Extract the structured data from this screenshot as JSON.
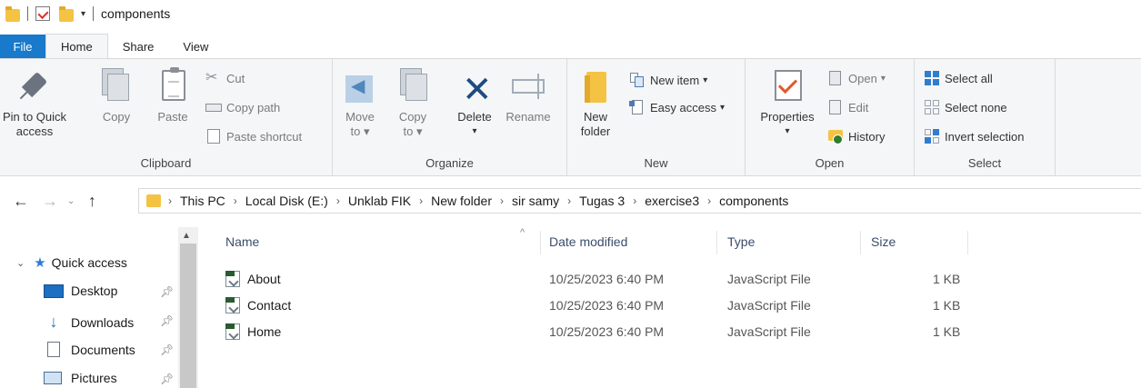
{
  "window": {
    "title": "components"
  },
  "tabs": [
    {
      "label": "File"
    },
    {
      "label": "Home"
    },
    {
      "label": "Share"
    },
    {
      "label": "View"
    }
  ],
  "ribbon": {
    "clipboard": {
      "group_label": "Clipboard",
      "pin_label_1": "Pin to Quick",
      "pin_label_2": "access",
      "copy_label": "Copy",
      "paste_label": "Paste",
      "cut_label": "Cut",
      "copy_path_label": "Copy path",
      "paste_shortcut_label": "Paste shortcut"
    },
    "organize": {
      "group_label": "Organize",
      "move_label_1": "Move",
      "move_label_2": "to",
      "copy_label_1": "Copy",
      "copy_label_2": "to",
      "delete_label": "Delete",
      "rename_label": "Rename"
    },
    "new": {
      "group_label": "New",
      "new_folder_1": "New",
      "new_folder_2": "folder",
      "new_item_label": "New item",
      "easy_access_label": "Easy access"
    },
    "open": {
      "group_label": "Open",
      "properties_label": "Properties",
      "open_label": "Open",
      "edit_label": "Edit",
      "history_label": "History"
    },
    "select": {
      "group_label": "Select",
      "select_all_label": "Select all",
      "select_none_label": "Select none",
      "invert_label": "Invert selection"
    }
  },
  "breadcrumb": [
    "This PC",
    "Local Disk (E:)",
    "Unklab FIK",
    "New folder",
    "sir samy",
    "Tugas 3",
    "exercise3",
    "components"
  ],
  "nav_pane": {
    "quick_access": "Quick access",
    "items": [
      {
        "label": "Desktop"
      },
      {
        "label": "Downloads"
      },
      {
        "label": "Documents"
      },
      {
        "label": "Pictures"
      }
    ]
  },
  "columns": {
    "name": "Name",
    "date": "Date modified",
    "type": "Type",
    "size": "Size"
  },
  "files": [
    {
      "name": "About",
      "date": "10/25/2023 6:40 PM",
      "type": "JavaScript File",
      "size": "1 KB"
    },
    {
      "name": "Contact",
      "date": "10/25/2023 6:40 PM",
      "type": "JavaScript File",
      "size": "1 KB"
    },
    {
      "name": "Home",
      "date": "10/25/2023 6:40 PM",
      "type": "JavaScript File",
      "size": "1 KB"
    }
  ],
  "colors": {
    "accent": "#1979ca",
    "folder": "#f4c343",
    "ribbon_bg": "#f5f6f7"
  }
}
